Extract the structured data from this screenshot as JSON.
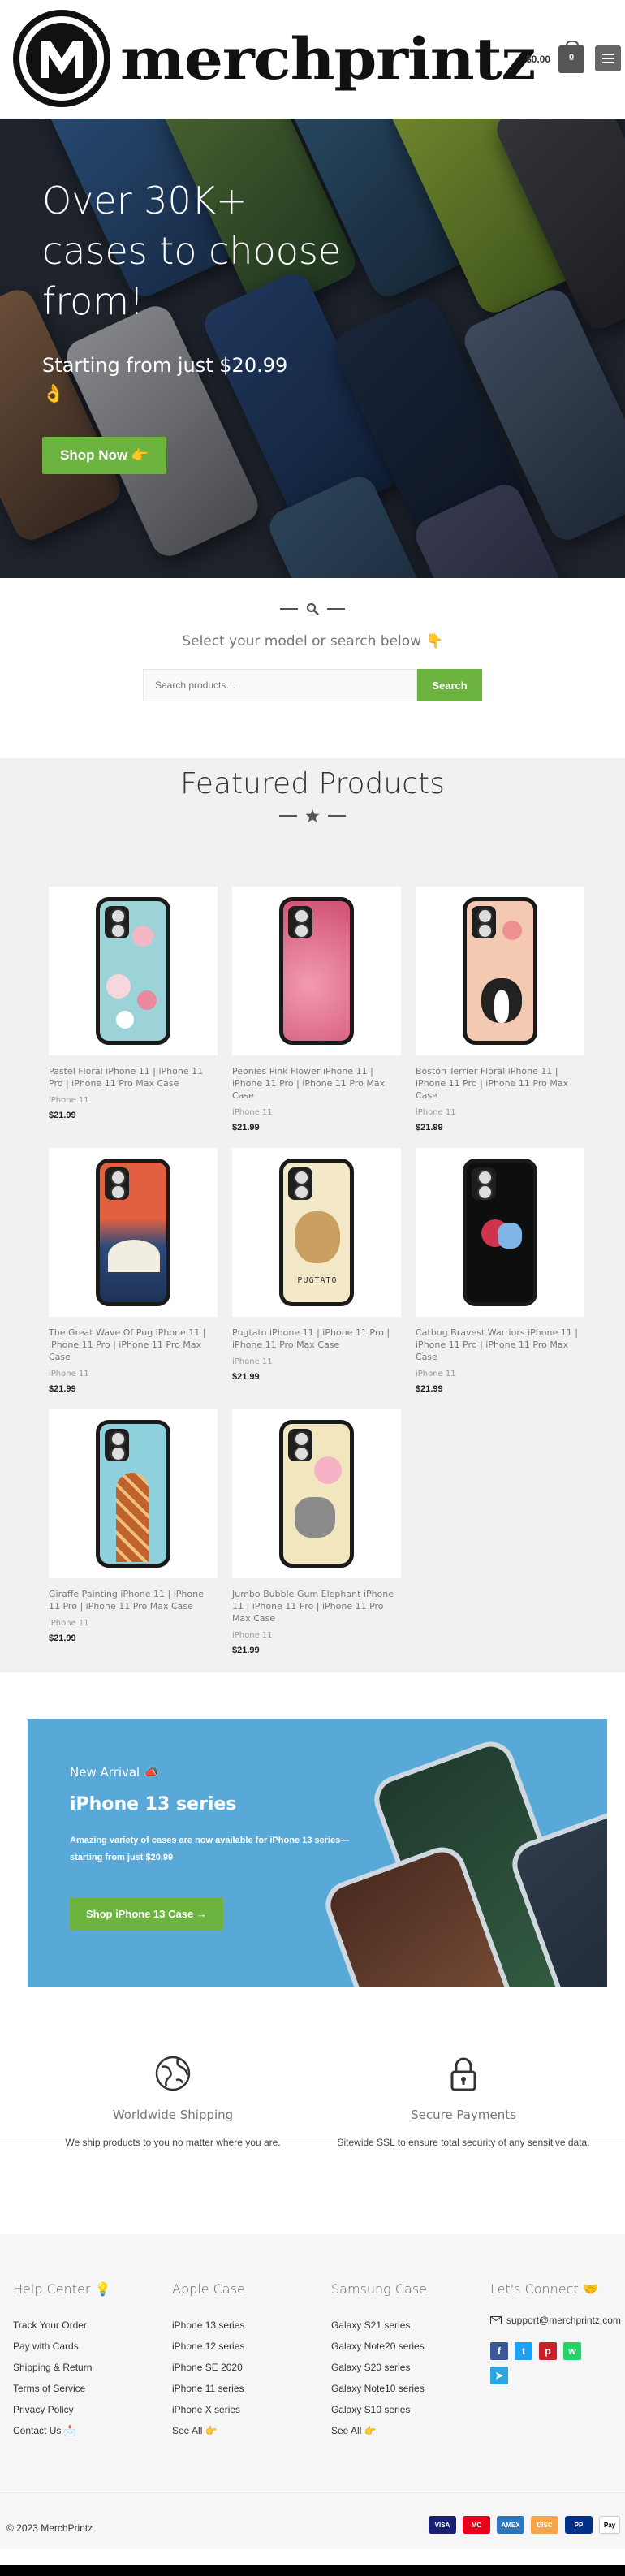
{
  "header": {
    "brand": "merchprintz",
    "logo_icon": "m-circle-logo",
    "cart_total": "$0.00",
    "cart_count": "0"
  },
  "hero": {
    "title": "Over 30K+ cases to choose from!",
    "subtitle": "Starting from just $20.99",
    "subtitle_emoji": "👌",
    "button": "Shop Now 👉"
  },
  "search": {
    "title": "Select your model or search below 👇",
    "placeholder": "Search products…",
    "button": "Search"
  },
  "featured": {
    "title": "Featured Products",
    "products": [
      {
        "name": "Pastel Floral iPhone 11 | iPhone 11 Pro | iPhone 11 Pro Max Case",
        "category": "iPhone 11",
        "price": "$21.99"
      },
      {
        "name": "Peonies Pink Flower iPhone 11 | iPhone 11 Pro | iPhone 11 Pro Max Case",
        "category": "iPhone 11",
        "price": "$21.99"
      },
      {
        "name": "Boston Terrier Floral iPhone 11 | iPhone 11 Pro | iPhone 11 Pro Max Case",
        "category": "iPhone 11",
        "price": "$21.99"
      },
      {
        "name": "The Great Wave Of Pug iPhone 11 | iPhone 11 Pro | iPhone 11 Pro Max Case",
        "category": "iPhone 11",
        "price": "$21.99"
      },
      {
        "name": "Pugtato iPhone 11 | iPhone 11 Pro | iPhone 11 Pro Max Case",
        "category": "iPhone 11",
        "price": "$21.99"
      },
      {
        "name": "Catbug Bravest Warriors iPhone 11 | iPhone 11 Pro | iPhone 11 Pro Max Case",
        "category": "iPhone 11",
        "price": "$21.99"
      },
      {
        "name": "Giraffe Painting iPhone 11 | iPhone 11 Pro | iPhone 11 Pro Max Case",
        "category": "iPhone 11",
        "price": "$21.99"
      },
      {
        "name": "Jumbo Bubble Gum Elephant iPhone 11 | iPhone 11 Pro | iPhone 11 Pro Max Case",
        "category": "iPhone 11",
        "price": "$21.99"
      }
    ]
  },
  "promo": {
    "label": "New Arrival 📣",
    "title": "iPhone 13 series",
    "description": "Amazing variety of cases are now available for iPhone 13 series—starting from just $20.99",
    "button": "Shop iPhone 13 Case →"
  },
  "features": [
    {
      "icon": "globe-icon",
      "title": "Worldwide Shipping",
      "text": "We ship products to you no matter where you are."
    },
    {
      "icon": "lock-icon",
      "title": "Secure Payments",
      "text": "Sitewide SSL to ensure total security of any sensitive data."
    }
  ],
  "footer": {
    "help": {
      "title": "Help Center 💡",
      "items": [
        "Track Your Order",
        "Pay with Cards",
        "Shipping & Return",
        "Terms of Service",
        "Privacy Policy",
        "Contact Us 📩"
      ]
    },
    "apple": {
      "title": "Apple Case",
      "items": [
        "iPhone 13 series",
        "iPhone 12 series",
        "iPhone SE 2020",
        "iPhone 11 series",
        "iPhone X series",
        "See All 👉"
      ]
    },
    "samsung": {
      "title": "Samsung Case",
      "items": [
        "Galaxy S21 series",
        "Galaxy Note20 series",
        "Galaxy S20 series",
        "Galaxy Note10 series",
        "Galaxy S10 series",
        "See All 👉"
      ]
    },
    "connect": {
      "title": "Let's Connect 🤝",
      "email": "support@merchprintz.com"
    },
    "copyright": "© 2023 MerchPrintz",
    "payments": [
      "VISA",
      "MC",
      "AMEX",
      "DISC",
      "PP",
      "Pay"
    ]
  },
  "colors": {
    "accent_green": "#6cb33f",
    "promo_blue": "#58a9d8",
    "featured_bg": "#f1f1f1"
  }
}
